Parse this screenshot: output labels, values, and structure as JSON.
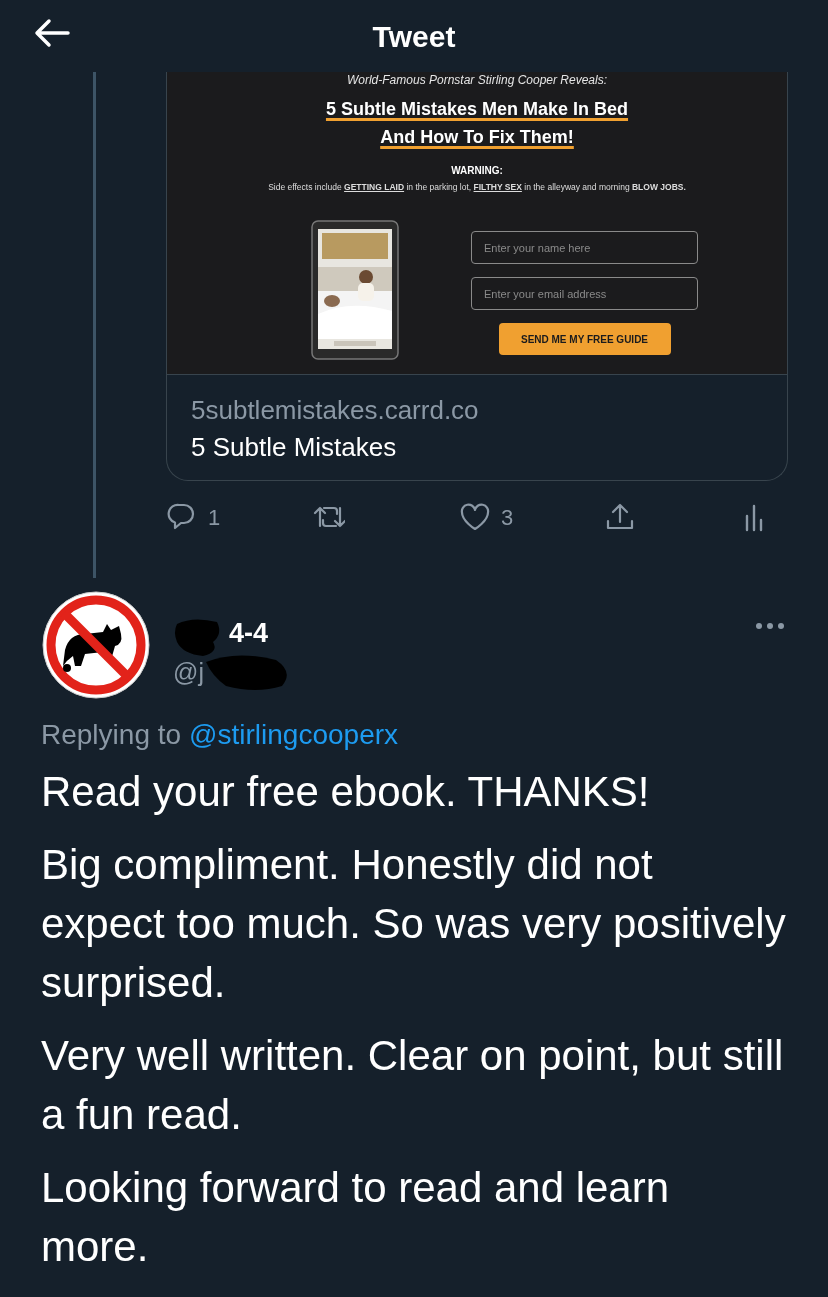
{
  "header": {
    "title": "Tweet"
  },
  "card": {
    "kicker": "World-Famous Pornstar Stirling Cooper Reveals:",
    "headline": [
      "5 Subtle Mistakes Men Make In Bed",
      "And How To Fix Them!"
    ],
    "warning_label": "WARNING:",
    "warning_segments": [
      {
        "kind": "plain",
        "text": "Side effects include "
      },
      {
        "kind": "underline",
        "text": "GETTING LAID"
      },
      {
        "kind": "plain",
        "text": " in the parking lot, "
      },
      {
        "kind": "underline",
        "text": "FILTHY SEX"
      },
      {
        "kind": "plain",
        "text": " in the alleyway and morning "
      },
      {
        "kind": "bold",
        "text": "BLOW JOBS."
      }
    ],
    "fields": [
      {
        "placeholder": "Enter your name here"
      },
      {
        "placeholder": "Enter your email address"
      }
    ],
    "button": "SEND ME MY FREE GUIDE",
    "domain": "5subtlemistakes.carrd.co",
    "title": "5 Subtle Mistakes"
  },
  "actions": [
    {
      "kind": "reply",
      "count": "1"
    },
    {
      "kind": "retweet"
    },
    {
      "kind": "like",
      "count": "3"
    },
    {
      "kind": "share"
    },
    {
      "kind": "analytics"
    }
  ],
  "reply": {
    "name": "4-4",
    "handle": "@j",
    "replying_label": "Replying to",
    "replying_to": "@stirlingcooperx",
    "paragraphs": [
      "Read your free ebook. THANKS!",
      "Big compliment. Honestly did not expect too much. So was very positively surprised.",
      "Very well written. Clear on point, but still a fun read.",
      "Looking forward to read and learn more."
    ]
  }
}
